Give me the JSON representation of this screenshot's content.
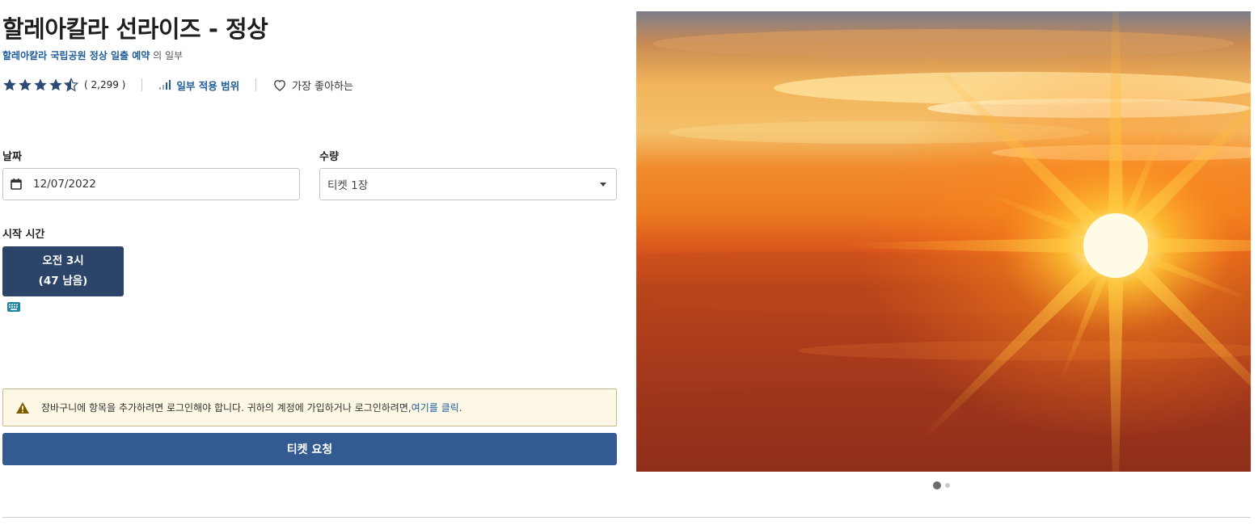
{
  "product": {
    "title": "할레아칼라 선라이즈 - 정상",
    "subtitle_link": "할레아칼라 국립공원 정상 일출 예약",
    "subtitle_suffix": " 의 일부"
  },
  "rating": {
    "stars": 4.5,
    "count_text": "( 2,299 )"
  },
  "coverage": {
    "label": "일부 적용 범위",
    "icon": "signal-bars-icon"
  },
  "favorite": {
    "label": "가장 좋아하는",
    "icon": "heart-outline-icon"
  },
  "date": {
    "label": "날짜",
    "value": "12/07/2022",
    "icon": "calendar-icon"
  },
  "quantity": {
    "label": "수량",
    "value": "티켓 1장"
  },
  "start_time": {
    "label": "시작 시간",
    "slot_time": "오전 3시",
    "slot_remaining": "(47 남음)"
  },
  "alert": {
    "text": "장바구니에 항목을 추가하려면 로그인해야 합니다. 귀하의 계정에 가입하거나 로그인하려면, ",
    "link": "여기를 클릭",
    "end": "."
  },
  "cta": {
    "label": "티켓 요청"
  },
  "gallery": {
    "slide_count": 2,
    "active_index": 0
  },
  "colors": {
    "primary_button": "#335b91",
    "time_slot": "#2b4468",
    "link": "#1f5d99",
    "alert_bg": "#fdf7e5",
    "star": "#2c4a73"
  }
}
